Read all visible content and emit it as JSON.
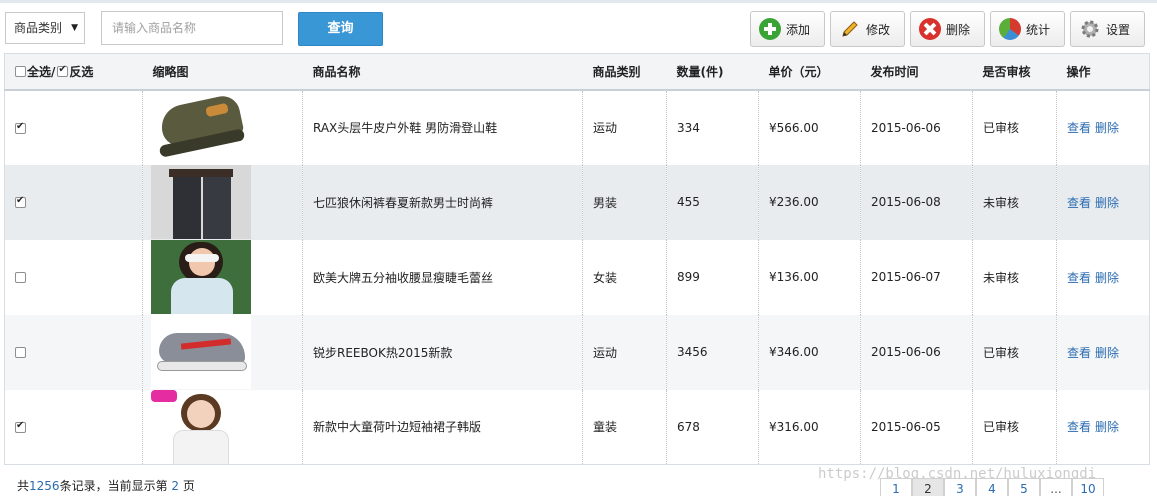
{
  "toolbar": {
    "category_select": "商品类别",
    "search_placeholder": "请输入商品名称",
    "query_label": "查询",
    "buttons": {
      "add": "添加",
      "edit": "修改",
      "delete": "删除",
      "stats": "统计",
      "settings": "设置"
    }
  },
  "table": {
    "headers": {
      "select_all": "全选/",
      "invert": "反选",
      "thumb": "缩略图",
      "name": "商品名称",
      "category": "商品类别",
      "qty": "数量(件)",
      "price": "单价（元）",
      "date": "发布时间",
      "audit": "是否审核",
      "ops": "操作"
    },
    "rows": [
      {
        "checked": true,
        "name": "RAX头层牛皮户外鞋 男防滑登山鞋",
        "category": "运动",
        "qty": "334",
        "price": "¥566.00",
        "date": "2015-06-06",
        "audit": "已审核",
        "view": "查看",
        "del": "删除"
      },
      {
        "checked": true,
        "name": "七匹狼休闲裤春夏新款男士时尚裤",
        "category": "男装",
        "qty": "455",
        "price": "¥236.00",
        "date": "2015-06-08",
        "audit": "未审核",
        "view": "查看",
        "del": "删除"
      },
      {
        "checked": false,
        "name": "欧美大牌五分袖收腰显瘦睫毛蕾丝",
        "category": "女装",
        "qty": "899",
        "price": "¥136.00",
        "date": "2015-06-07",
        "audit": "未审核",
        "view": "查看",
        "del": "删除"
      },
      {
        "checked": false,
        "name": "锐步REEBOK热2015新款",
        "category": "运动",
        "qty": "3456",
        "price": "¥346.00",
        "date": "2015-06-06",
        "audit": "已审核",
        "view": "查看",
        "del": "删除"
      },
      {
        "checked": true,
        "name": "新款中大童荷叶边短袖裙子韩版",
        "category": "童装",
        "qty": "678",
        "price": "¥316.00",
        "date": "2015-06-05",
        "audit": "已审核",
        "view": "查看",
        "del": "删除"
      }
    ]
  },
  "footer": {
    "prefix": "共",
    "total": "1256",
    "mid": "条记录，当前显示第",
    "page": "2",
    "suffix": "页"
  },
  "pager": [
    "1",
    "2",
    "3",
    "4",
    "5",
    "...",
    "10"
  ],
  "watermark": "https://blog.csdn.net/huluxiongdi",
  "icons": {
    "add": "plus-circle-green",
    "edit": "pencil",
    "delete": "x-circle-red",
    "stats": "pie-chart",
    "settings": "gear"
  }
}
